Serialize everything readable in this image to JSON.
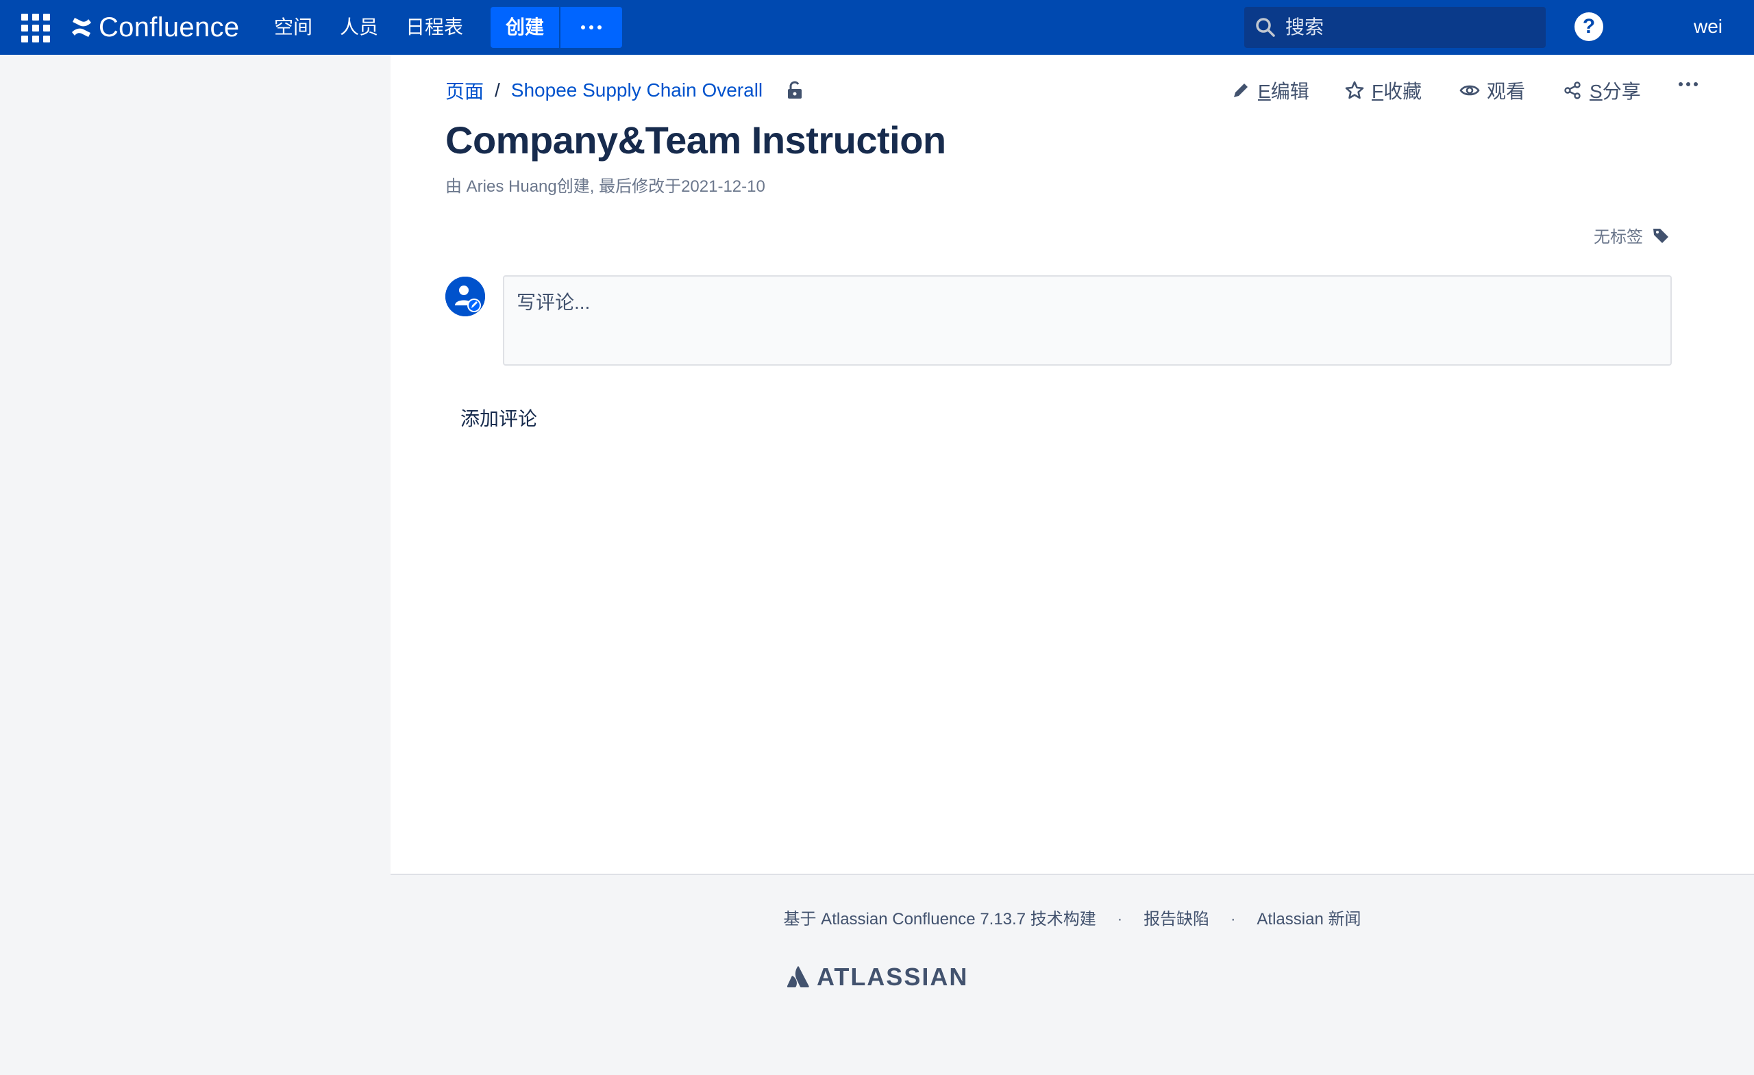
{
  "topnav": {
    "logo_text": "Confluence",
    "links": [
      "空间",
      "人员",
      "日程表"
    ],
    "create_label": "创建",
    "search_placeholder": "搜索",
    "help_label": "?",
    "user_name": "wei"
  },
  "breadcrumb": {
    "root": "页面",
    "separator": "/",
    "parent": "Shopee Supply Chain Overall"
  },
  "actions": {
    "edit": {
      "key": "E",
      "label": "编辑"
    },
    "favourite": {
      "key": "F",
      "label": "收藏"
    },
    "watch": {
      "label": "观看"
    },
    "share": {
      "key": "S",
      "label": "分享"
    }
  },
  "page": {
    "title": "Company&Team Instruction",
    "byline": "由 Aries Huang创建, 最后修改于2021-12-10",
    "labels_text": "无标签"
  },
  "comments": {
    "placeholder": "写评论...",
    "add_label": "添加评论"
  },
  "footer": {
    "built_with": "基于 Atlassian Confluence 7.13.7 技术构建",
    "report_bug": "报告缺陷",
    "news": "Atlassian 新闻",
    "dot": "·",
    "brand": "ATLASSIAN"
  },
  "colors": {
    "nav_bg": "#0049b0",
    "accent": "#0065ff",
    "link": "#0052cc"
  }
}
